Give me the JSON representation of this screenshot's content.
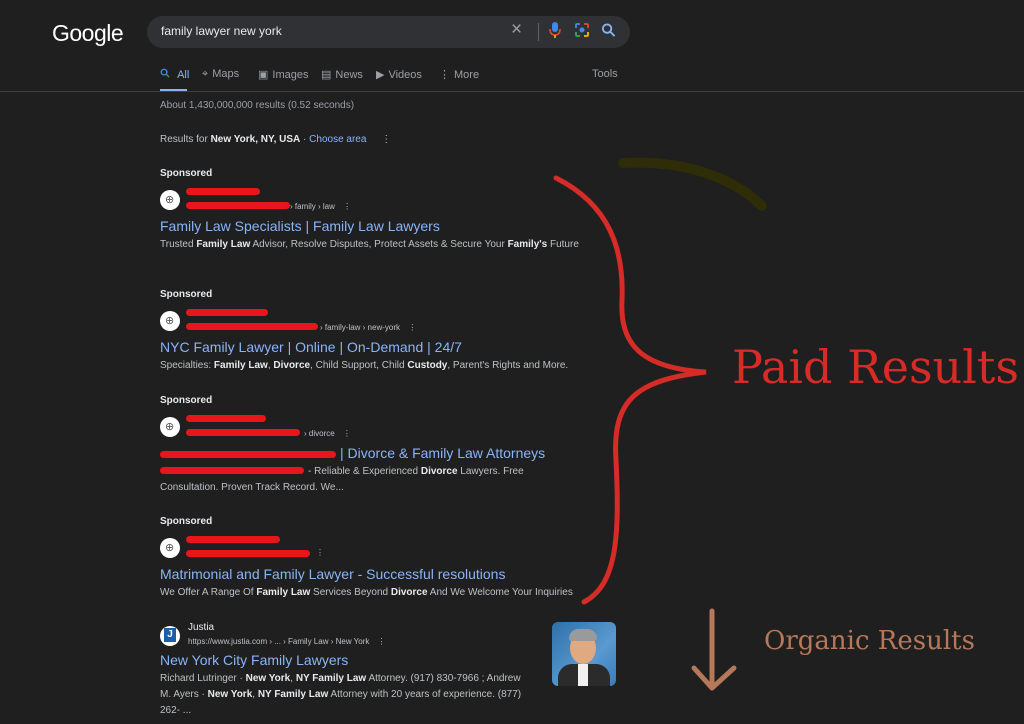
{
  "header": {
    "logo": "Google",
    "search_query": "family lawyer new york",
    "icons": [
      "clear-icon",
      "mic-icon",
      "lens-icon",
      "search-icon"
    ]
  },
  "tabs": [
    {
      "label": "All",
      "icon": "search-icon",
      "active": true
    },
    {
      "label": "Maps",
      "icon": "map-pin-icon"
    },
    {
      "label": "Images",
      "icon": "image-icon"
    },
    {
      "label": "News",
      "icon": "news-icon"
    },
    {
      "label": "Videos",
      "icon": "video-icon"
    },
    {
      "label": "More",
      "icon": "more-vert-icon"
    }
  ],
  "tools_label": "Tools",
  "stats": "About 1,430,000,000 results (0.52 seconds)",
  "location": {
    "prefix": "Results for",
    "place": "New York, NY, USA",
    "sep": "·",
    "link": "Choose area"
  },
  "ads": [
    {
      "label": "Sponsored",
      "crumb": "› family › law",
      "title": "Family Law Specialists | Family Law Lawyers",
      "desc": [
        "Trusted ",
        {
          "b": "Family Law"
        },
        " Advisor, Resolve Disputes, Protect Assets & Secure Your ",
        {
          "b": "Family's"
        },
        " Future"
      ]
    },
    {
      "label": "Sponsored",
      "crumb": "› family-law › new-york",
      "title": "NYC Family Lawyer | Online | On-Demand | 24/7",
      "desc": [
        "Specialties: ",
        {
          "b": "Family Law"
        },
        ", ",
        {
          "b": "Divorce"
        },
        ", Child Support, Child ",
        {
          "b": "Custody"
        },
        ", Parent's Rights and More."
      ]
    },
    {
      "label": "Sponsored",
      "crumb": "› divorce",
      "title": "| Divorce & Family Law Attorneys",
      "desc": [
        "- Reliable & Experienced ",
        {
          "b": "Divorce"
        },
        " Lawyers. Free Consultation. Proven Track Record. We..."
      ]
    },
    {
      "label": "Sponsored",
      "crumb": "",
      "title": "Matrimonial and Family Lawyer - Successful resolutions",
      "desc": [
        "We Offer A Range Of ",
        {
          "b": "Family Law"
        },
        " Services Beyond ",
        {
          "b": "Divorce"
        },
        " And We Welcome Your Inquiries"
      ]
    }
  ],
  "organic": {
    "site_name": "Justia",
    "url": "https://www.justia.com › ... › Family Law › New York",
    "title": "New York City Family Lawyers",
    "desc": [
      "Richard Lutringer · ",
      {
        "b": "New York"
      },
      ", ",
      {
        "b": "NY Family Law"
      },
      " Attorney. (917) 830-7966 ; Andrew M. Ayers · ",
      {
        "b": "New York"
      },
      ", ",
      {
        "b": "NY Family Law"
      },
      " Attorney with 20 years of experience. (877) 262- ..."
    ]
  },
  "annotations": {
    "paid": "Paid Results",
    "organic": "Organic Results",
    "colors": {
      "paid": "#d62b27",
      "organic": "#b5785a",
      "redaction": "#e8161b"
    }
  }
}
